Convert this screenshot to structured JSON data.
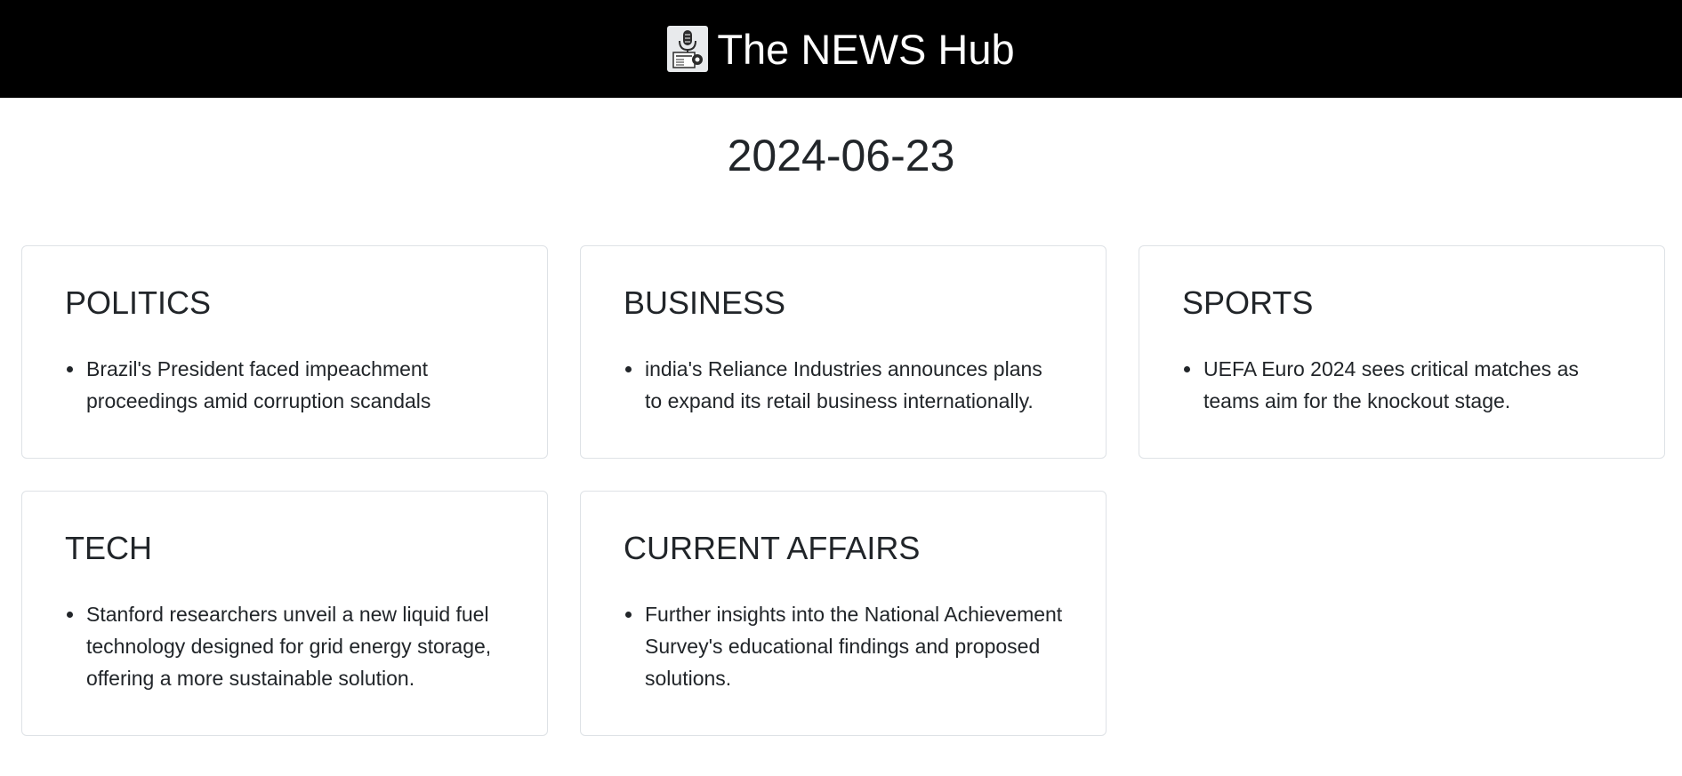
{
  "header": {
    "title": "The NEWS Hub",
    "logo_icon": "microphone-newspaper-icon"
  },
  "date": "2024-06-23",
  "sections": [
    {
      "title": "POLITICS",
      "items": [
        "Brazil's President faced impeachment proceedings amid corruption scandals"
      ]
    },
    {
      "title": "BUSINESS",
      "items": [
        "india's Reliance Industries announces plans to expand its retail business internationally."
      ]
    },
    {
      "title": "SPORTS",
      "items": [
        "UEFA Euro 2024 sees critical matches as teams aim for the knockout stage."
      ]
    },
    {
      "title": "TECH",
      "items": [
        "Stanford researchers unveil a new liquid fuel technology designed for grid energy storage, offering a more sustainable solution."
      ]
    },
    {
      "title": "CURRENT AFFAIRS",
      "items": [
        "Further insights into the National Achievement Survey's educational findings and proposed solutions."
      ]
    }
  ],
  "colors": {
    "navbar_bg": "#000000",
    "navbar_text": "#ffffff",
    "card_border": "#dee2e6",
    "text": "#212529"
  }
}
